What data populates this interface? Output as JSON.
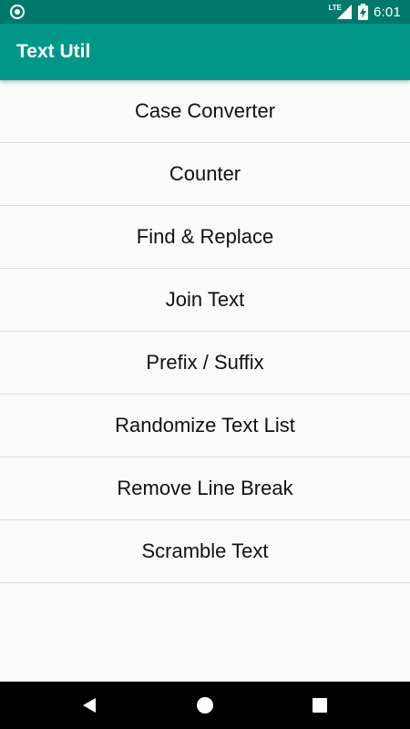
{
  "status_bar": {
    "network_label": "LTE",
    "time": "6:01",
    "icons": [
      "circle-notification-icon",
      "signal-icon",
      "battery-charging-icon"
    ]
  },
  "app_bar": {
    "title": "Text Util",
    "color": "#009688",
    "status_color": "#00796b"
  },
  "menu": {
    "items": [
      "Case Converter",
      "Counter",
      "Find & Replace",
      "Join Text",
      "Prefix / Suffix",
      "Randomize Text List",
      "Remove Line Break",
      "Scramble Text"
    ]
  },
  "nav_bar": {
    "icons": [
      "back-icon",
      "home-icon",
      "recents-icon"
    ]
  }
}
